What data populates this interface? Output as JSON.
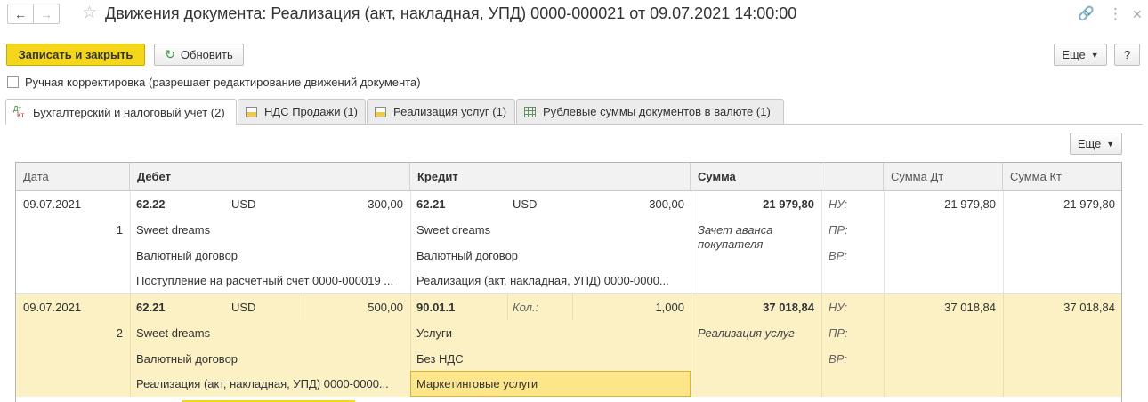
{
  "window": {
    "title": "Движения документа: Реализация (акт, накладная, УПД) 0000-000021 от 09.07.2021 14:00:00",
    "back_icon": "←",
    "forward_icon": "→",
    "star_icon": "☆",
    "link_icon": "🔗",
    "menu_icon": "⋮",
    "maximize_icon": "☐",
    "close_icon": "✕"
  },
  "toolbar": {
    "save_close": "Записать и закрыть",
    "refresh": "Обновить",
    "more": "Еще",
    "help": "?"
  },
  "manual_edit": {
    "label": "Ручная корректировка (разрешает редактирование движений документа)",
    "checked": false
  },
  "tabs": [
    {
      "label": "Бухгалтерский и налоговый учет (2)",
      "icon": "Дт Кт",
      "active": true
    },
    {
      "label": "НДС Продажи (1)",
      "icon": "register-icon"
    },
    {
      "label": "Реализация услуг (1)",
      "icon": "register-icon"
    },
    {
      "label": "Рублевые суммы документов в валюте (1)",
      "icon": "table-icon"
    }
  ],
  "table": {
    "more": "Еще",
    "columns": [
      "Дата",
      "Дебет",
      "Кредит",
      "Сумма",
      "",
      "Сумма Дт",
      "Сумма Кт"
    ],
    "rows": [
      {
        "date": "09.07.2021",
        "num": "1",
        "debit_account": "62.22",
        "debit_currency": "USD",
        "debit_amount": "300,00",
        "debit_sub1": "Sweet dreams",
        "debit_sub2": "Валютный договор",
        "debit_sub3": "Поступление на расчетный счет 0000-000019 ...",
        "credit_account": "62.21",
        "credit_currency": "USD",
        "credit_amount": "300,00",
        "credit_sub1": "Sweet dreams",
        "credit_sub2": "Валютный договор",
        "credit_sub3": "Реализация (акт, накладная, УПД) 0000-0000...",
        "sum": "21 979,80",
        "content": "Зачет аванса покупателя",
        "nu": "НУ:",
        "pr": "ПР:",
        "vr": "ВР:",
        "sum_dt": "21 979,80",
        "sum_kt": "21 979,80"
      },
      {
        "date": "09.07.2021",
        "num": "2",
        "debit_account": "62.21",
        "debit_currency": "USD",
        "debit_amount": "500,00",
        "debit_sub1": "Sweet dreams",
        "debit_sub2": "Валютный договор",
        "debit_sub3": "Реализация (акт, накладная, УПД) 0000-0000...",
        "credit_account": "90.01.1",
        "credit_qty_label": "Кол.:",
        "credit_qty": "1,000",
        "credit_sub1": "Услуги",
        "credit_sub2": "Без НДС",
        "credit_sub3": "Маркетинговые услуги",
        "sum": "37 018,84",
        "content": "Реализация услуг",
        "nu": "НУ:",
        "pr": "ПР:",
        "vr": "ВР:",
        "sum_dt": "37 018,84",
        "sum_kt": "37 018,84"
      }
    ]
  }
}
